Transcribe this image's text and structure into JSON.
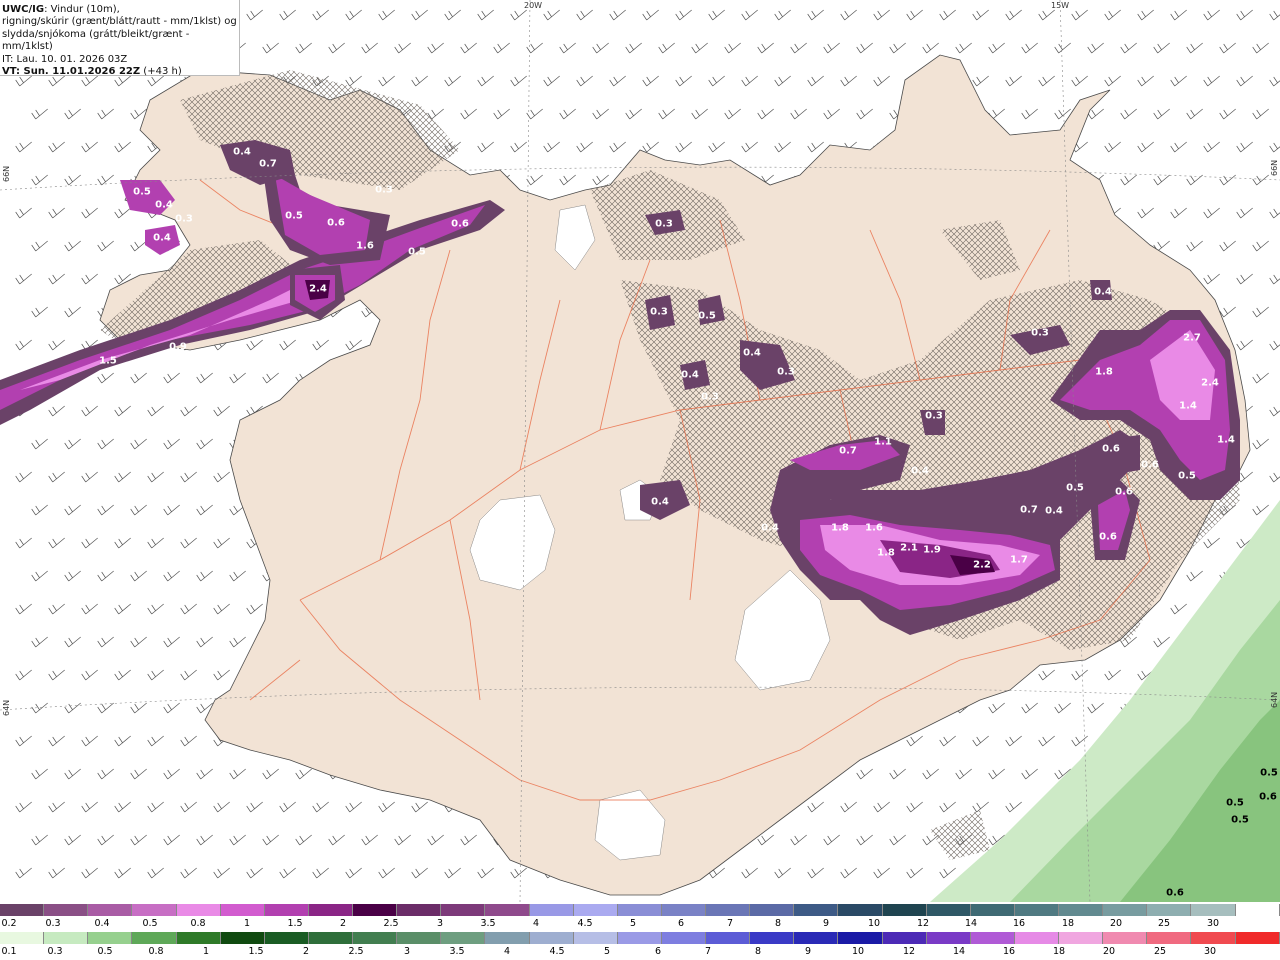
{
  "header": {
    "model": "UWC/IG",
    "line1": ": Vindur (10m),",
    "line2": "rigning/skúrir (grænt/blátt/rautt - mm/1klst) og",
    "line3": "slydda/snjókoma (grátt/bleikt/grænt - mm/1klst)",
    "it": "IT: Lau. 10. 01. 2026 03Z",
    "vt": "VT: Sun. 11.01.2026 22Z",
    "lead": " (+43 h)"
  },
  "grid_labels": {
    "lon_20w": "20W",
    "lon_15w": "15W",
    "lat_66n_left": "66N",
    "lat_66n_right": "66N",
    "lat_64n_left": "64N",
    "lat_64n_right": "64N"
  },
  "values": [
    {
      "t": "0.4"
    },
    {
      "t": "0.7"
    },
    {
      "t": "0.5"
    },
    {
      "t": "0.4"
    },
    {
      "t": "0.3"
    },
    {
      "t": "0.4"
    },
    {
      "t": "0.3"
    },
    {
      "t": "0.5"
    },
    {
      "t": "0.6"
    },
    {
      "t": "1.6"
    },
    {
      "t": "0.6"
    },
    {
      "t": "0.5"
    },
    {
      "t": "2.4"
    },
    {
      "t": "1.5"
    },
    {
      "t": "0.9"
    },
    {
      "t": "0.3"
    },
    {
      "t": "0.3"
    },
    {
      "t": "0.5"
    },
    {
      "t": "0.4"
    },
    {
      "t": "0.3"
    },
    {
      "t": "0.4"
    },
    {
      "t": "0.4"
    },
    {
      "t": "0.3"
    },
    {
      "t": "0.4"
    },
    {
      "t": "0.3"
    },
    {
      "t": "0.7"
    },
    {
      "t": "1.1"
    },
    {
      "t": "0.4"
    },
    {
      "t": "1.8"
    },
    {
      "t": "1.6"
    },
    {
      "t": "1.8"
    },
    {
      "t": "2.1"
    },
    {
      "t": "1.9"
    },
    {
      "t": "2.2"
    },
    {
      "t": "1.7"
    },
    {
      "t": "0.7"
    },
    {
      "t": "0.4"
    },
    {
      "t": "0.5"
    },
    {
      "t": "0.6"
    },
    {
      "t": "0.6"
    },
    {
      "t": "0.6"
    },
    {
      "t": "0.5"
    },
    {
      "t": "0.6"
    },
    {
      "t": "0.4"
    },
    {
      "t": "0.3"
    },
    {
      "t": "1.8"
    },
    {
      "t": "2.7"
    },
    {
      "t": "2.4"
    },
    {
      "t": "1.4"
    },
    {
      "t": "1.4"
    },
    {
      "t": "0.5"
    },
    {
      "t": "0.5"
    },
    {
      "t": "0.5"
    },
    {
      "t": "0.6"
    }
  ],
  "legend_top": {
    "colors": [
      "#6a4268",
      "#8a4f86",
      "#a95ca5",
      "#c76ec4",
      "#e98ae6",
      "#d25ccf",
      "#b240b0",
      "#8a2586",
      "#4a0046",
      "#6b2c68",
      "#7d3a7a",
      "#8f4a8c",
      "#9999e6",
      "#aaaaf0",
      "#8a8ed6",
      "#7a82c6",
      "#6a76b6",
      "#5b6aa6",
      "#3d5a86",
      "#2a4a66",
      "#1f4450",
      "#2f5866",
      "#3f6a74",
      "#507a82",
      "#628a90",
      "#789ca0",
      "#8eaeb0",
      "#a6bebe",
      "#ffffff"
    ],
    "labels": [
      "0.2",
      "0.3",
      "0.4",
      "0.5",
      "0.8",
      "1",
      "1.5",
      "2",
      "2.5",
      "3",
      "3.5",
      "4",
      "4.5",
      "5",
      "6",
      "7",
      "8",
      "9",
      "10",
      "12",
      "14",
      "16",
      "18",
      "20",
      "25",
      "30"
    ]
  },
  "legend_bottom": {
    "colors": [
      "#e8f8e0",
      "#c6eac0",
      "#96d08e",
      "#5ea858",
      "#2e7a28",
      "#104a10",
      "#1a5c24",
      "#2e6e3a",
      "#427e50",
      "#5a8e68",
      "#6e9e80",
      "#829eae",
      "#9eaed0",
      "#b6bee6",
      "#9a9ae6",
      "#7e7ee0",
      "#5c5cd6",
      "#3a3ac6",
      "#2a2ab6",
      "#1a1aa6",
      "#4c2ab6",
      "#7a3ac6",
      "#b05ad6",
      "#e68ae6",
      "#f0a6e0",
      "#f08ab0",
      "#f06a80",
      "#f04a50",
      "#f02a2a"
    ],
    "labels": [
      "0.1",
      "0.3",
      "0.5",
      "0.8",
      "1",
      "1.5",
      "2",
      "2.5",
      "3",
      "3.5",
      "4",
      "4.5",
      "5",
      "6",
      "7",
      "8",
      "9",
      "10",
      "12",
      "14",
      "16",
      "18",
      "20",
      "25",
      "30"
    ]
  }
}
